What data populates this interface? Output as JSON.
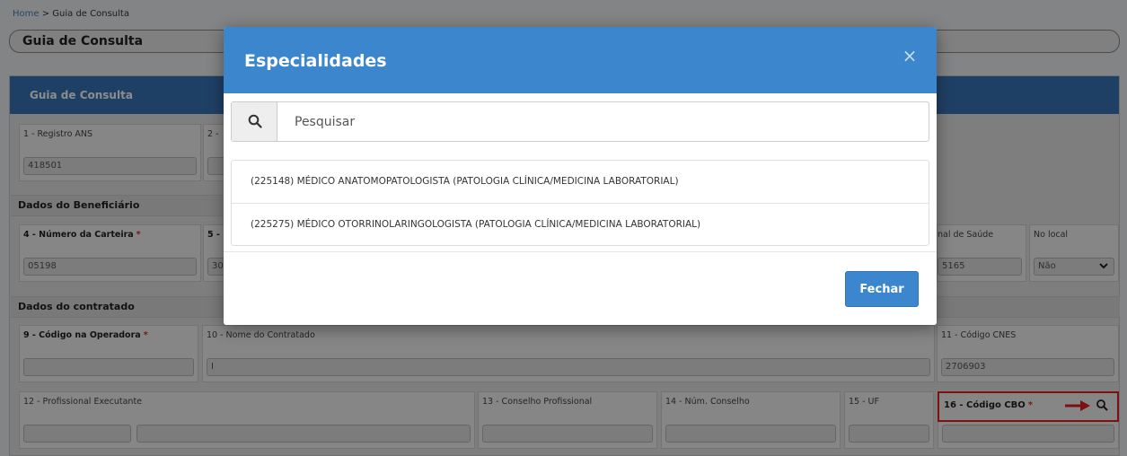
{
  "breadcrumb": {
    "home": "Home",
    "separator": " > ",
    "current": "Guia de Consulta"
  },
  "page": {
    "title": "Guia de Consulta"
  },
  "panel": {
    "title": "Guia de Consulta"
  },
  "fields": {
    "registro_ans": {
      "label": "1 - Registro ANS",
      "value": "418501"
    },
    "field2": {
      "label": "2 -"
    },
    "beneficiario_section": "Dados do Beneficiário",
    "numero_carteira": {
      "label": "4 - Número da Carteira",
      "value": "05198"
    },
    "field5": {
      "label": "5 -",
      "value": "30"
    },
    "cartao_saude": {
      "label": "nal de Saúde",
      "value": "5165"
    },
    "no_local": {
      "label": "No local",
      "value": "Não"
    },
    "contratado_section": "Dados do contratado",
    "codigo_operadora": {
      "label": "9 - Código na Operadora"
    },
    "nome_contratado": {
      "label": "10 - Nome do Contratado",
      "value": "I"
    },
    "codigo_cnes": {
      "label": "11 - Código CNES",
      "value": "2706903"
    },
    "profissional_executante": {
      "label": "12 - Profissional Executante"
    },
    "conselho_profissional": {
      "label": "13 - Conselho Profissional"
    },
    "num_conselho": {
      "label": "14 - Núm. Conselho"
    },
    "uf": {
      "label": "15 - UF"
    },
    "codigo_cbo": {
      "label": "16 - Código CBO"
    },
    "required_mark": "*"
  },
  "modal": {
    "title": "Especialidades",
    "close_glyph": "×",
    "search": {
      "placeholder": "Pesquisar",
      "value": ""
    },
    "results": [
      "(225148) MÉDICO ANATOMOPATOLOGISTA (PATOLOGIA CLÍNICA/MEDICINA LABORATORIAL)",
      "(225275) MÉDICO OTORRINOLARINGOLOGISTA (PATOLOGIA CLÍNICA/MEDICINA LABORATORIAL)"
    ],
    "close_label": "Fechar"
  },
  "colors": {
    "primary": "#3b86cc",
    "panel_header": "#3a76b8",
    "required": "#d9302c",
    "highlight": "#e02020"
  },
  "icons": {
    "search": "search-icon",
    "close": "close-icon",
    "arrow": "arrow-right-icon",
    "chevron": "chevron-down-icon"
  }
}
